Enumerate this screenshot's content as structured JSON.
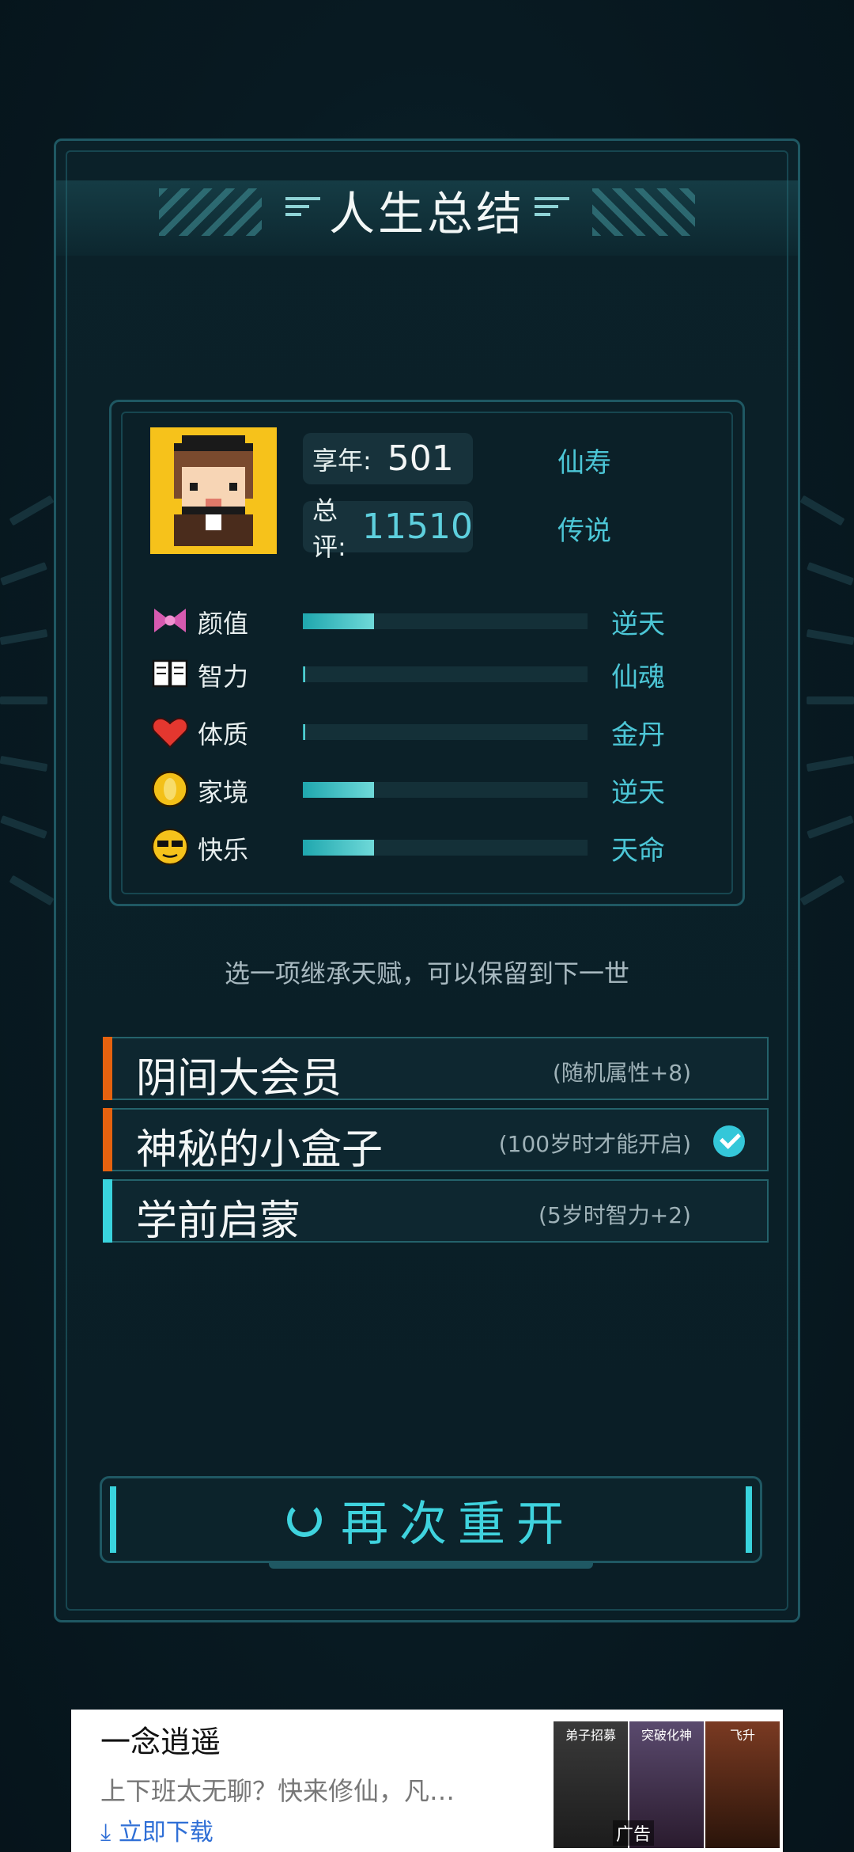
{
  "title": "人生总结",
  "summary": {
    "age_label": "享年:",
    "age_value": "501",
    "age_rank": "仙寿",
    "score_label": "总评:",
    "score_value": "11510",
    "score_rank": "传说"
  },
  "stats": [
    {
      "name": "颜值",
      "icon": "bow-icon",
      "fill": 0.25,
      "grade": "逆天"
    },
    {
      "name": "智力",
      "icon": "book-icon",
      "fill": 0.0,
      "grade": "仙魂"
    },
    {
      "name": "体质",
      "icon": "heart-icon",
      "fill": 0.0,
      "grade": "金丹"
    },
    {
      "name": "家境",
      "icon": "coin-icon",
      "fill": 0.25,
      "grade": "逆天"
    },
    {
      "name": "快乐",
      "icon": "sunglasses-face-icon",
      "fill": 0.25,
      "grade": "天命"
    }
  ],
  "hint": "选一项继承天赋，可以保留到下一世",
  "talents": [
    {
      "name": "阴间大会员",
      "desc": "(随机属性+8)",
      "accent": "#e6620f",
      "selected": false
    },
    {
      "name": "神秘的小盒子",
      "desc": "(100岁时才能开启)",
      "accent": "#e6620f",
      "selected": true
    },
    {
      "name": "学前启蒙",
      "desc": "(5岁时智力+2)",
      "accent": "#39d3dd",
      "selected": false
    }
  ],
  "restart_label": "再次重开",
  "ad": {
    "title": "一念逍遥",
    "desc": "上下班太无聊？快来修仙，凡…",
    "download": "立即下载",
    "thumb1_label": "弟子招募",
    "thumb2_label": "突破化神",
    "thumb3_label": "飞升",
    "tag": "广告"
  },
  "colors": {
    "accent_cyan": "#3fd3de",
    "panel_border": "#1f5863",
    "orange": "#e6620f"
  }
}
